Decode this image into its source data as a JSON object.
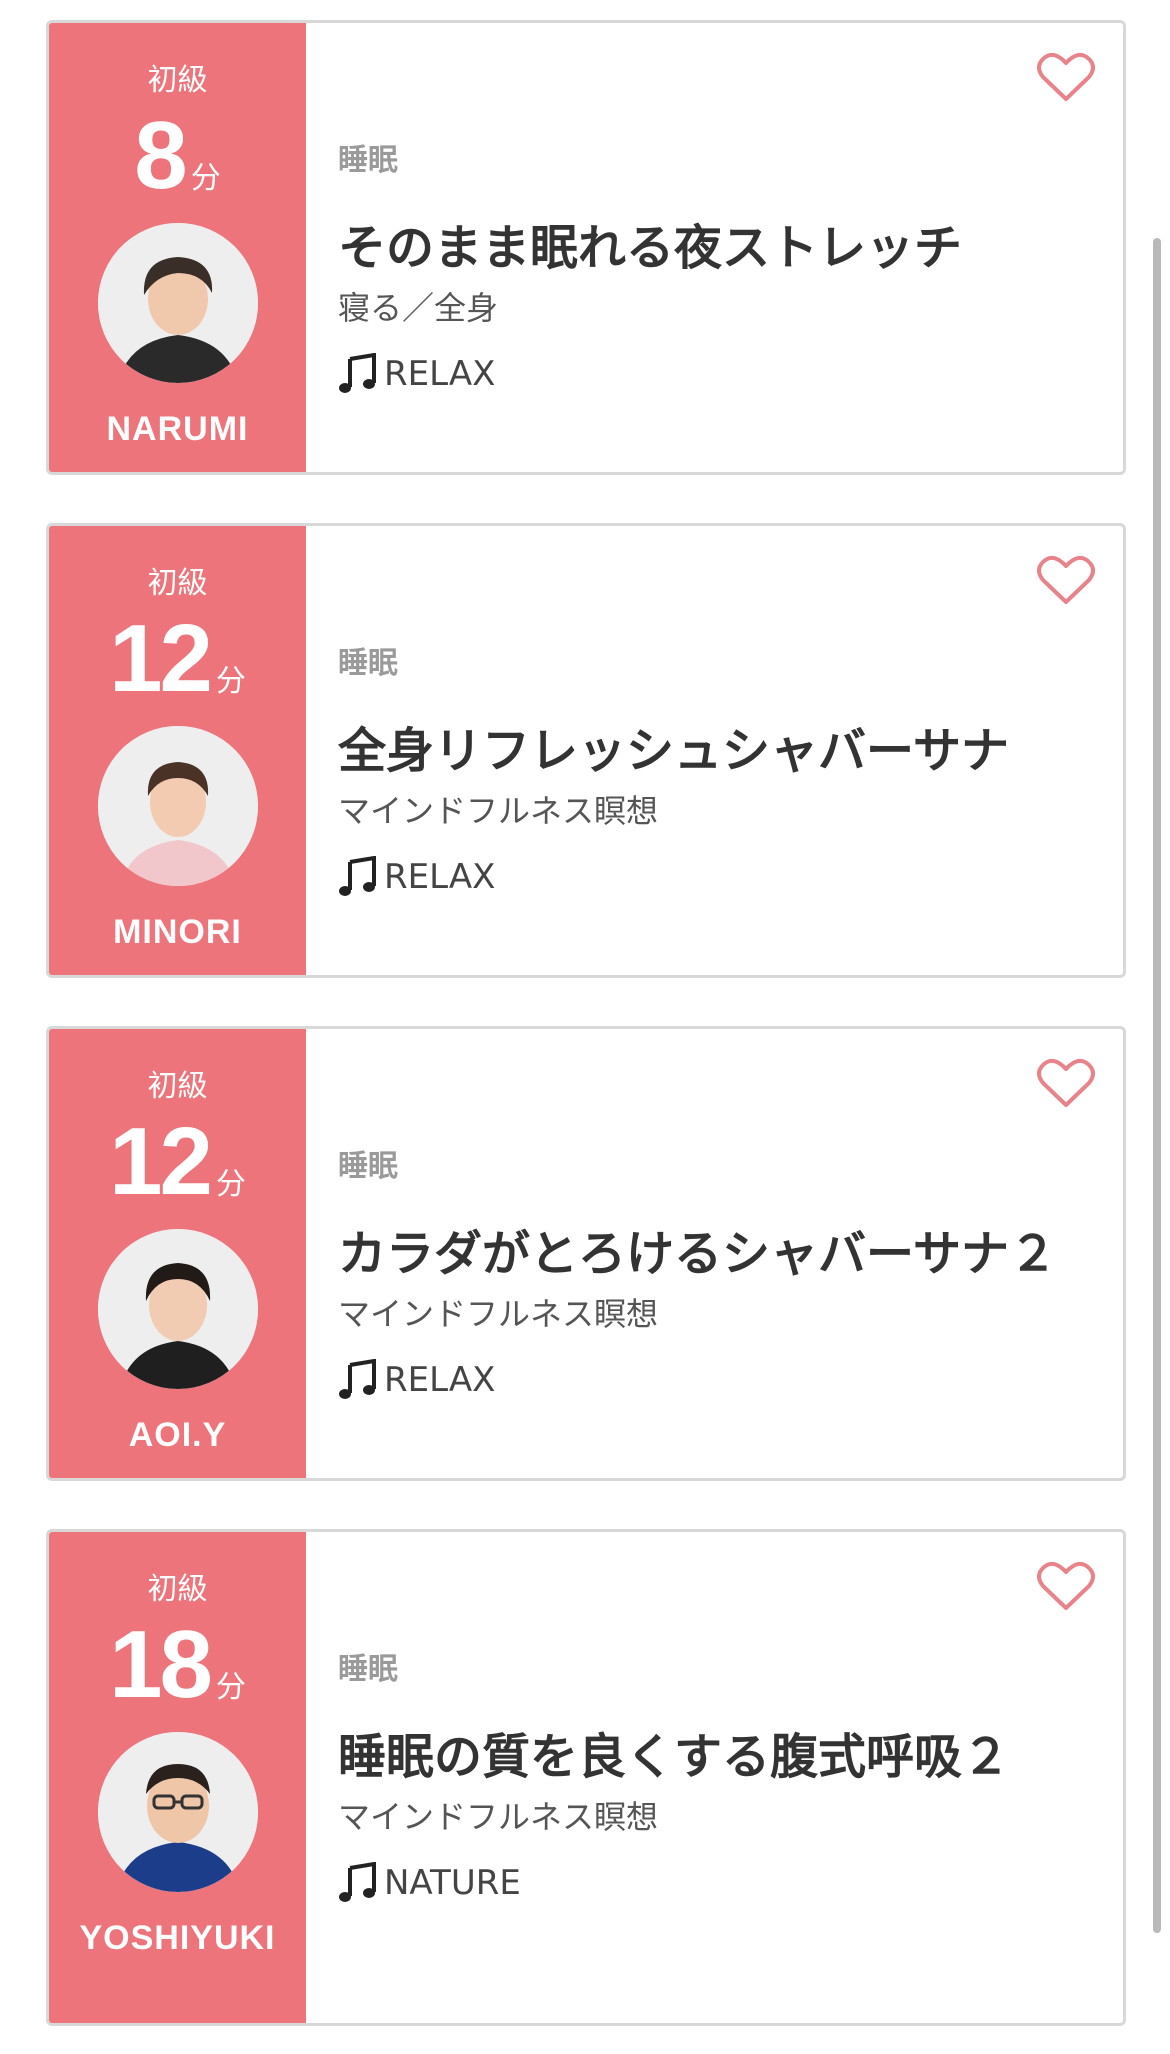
{
  "colors": {
    "accent": "#ed747a",
    "heart": "#e8838a"
  },
  "lessons": [
    {
      "level": "初級",
      "minutes": "8",
      "unit": "分",
      "instructor": "NARUMI",
      "category": "睡眠",
      "title": "そのまま眠れる夜ストレッチ",
      "subtitle": "寝る／全身",
      "music": "RELAX",
      "avatar": "instructor-photo"
    },
    {
      "level": "初級",
      "minutes": "12",
      "unit": "分",
      "instructor": "MINORI",
      "category": "睡眠",
      "title": "全身リフレッシュシャバーサナ",
      "subtitle": "マインドフルネス瞑想",
      "music": "RELAX",
      "avatar": "instructor-photo"
    },
    {
      "level": "初級",
      "minutes": "12",
      "unit": "分",
      "instructor": "AOI.Y",
      "category": "睡眠",
      "title": "カラダがとろけるシャバーサナ２",
      "subtitle": "マインドフルネス瞑想",
      "music": "RELAX",
      "avatar": "instructor-photo"
    },
    {
      "level": "初級",
      "minutes": "18",
      "unit": "分",
      "instructor": "YOSHIYUKI",
      "category": "睡眠",
      "title": "睡眠の質を良くする腹式呼吸２",
      "subtitle": "マインドフルネス瞑想",
      "music": "NATURE",
      "avatar": "instructor-photo"
    }
  ]
}
